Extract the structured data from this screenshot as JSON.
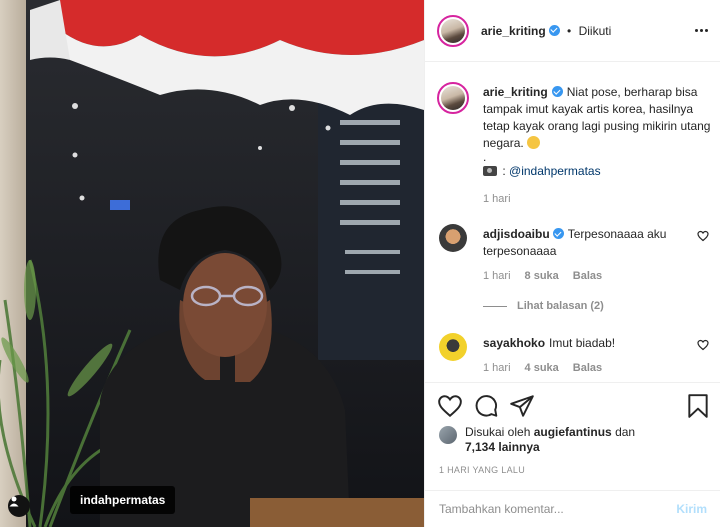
{
  "photo": {
    "tagged_user": "indahpermatas",
    "icons": {
      "tag": "person-tag-icon"
    }
  },
  "header": {
    "username": "arie_kriting",
    "separator": "•",
    "follow_status": "Diikuti",
    "icons": {
      "verified": "verified-badge-icon",
      "more": "more-options-icon"
    }
  },
  "caption": {
    "username": "arie_kriting",
    "text": "Niat pose, berharap bisa tampak imut kayak artis korea, hasilnya tetap kayak orang lagi pusing mikirin utang negara.",
    "emoji": "pensive-face-emoji",
    "dot": ".",
    "credit_prefix": ":",
    "credit_mention": "@indahpermatas",
    "time": "1 hari"
  },
  "comments": [
    {
      "username": "adjisdoaibu",
      "verified": true,
      "text": "Terpesonaaaa aku terpesonaaaa",
      "time": "1 hari",
      "likes": "8 suka",
      "reply": "Balas",
      "view_replies": "Lihat balasan (2)"
    },
    {
      "username": "sayakhoko",
      "verified": false,
      "text": "Imut biadab!",
      "time": "1 hari",
      "likes": "4 suka",
      "reply": "Balas"
    }
  ],
  "actions": {
    "icons": [
      "heart-icon",
      "comment-icon",
      "share-icon",
      "bookmark-icon"
    ],
    "liked_by_prefix": "Disukai oleh",
    "liked_by_user": "augiefantinus",
    "liked_by_and": "dan",
    "others": "7,134 lainnya",
    "post_date": "1 HARI YANG LALU"
  },
  "composer": {
    "placeholder": "Tambahkan komentar...",
    "post_label": "Kirim"
  },
  "colors": {
    "accent_blue": "#3897f0",
    "text": "#262626",
    "muted": "#8e8e8e",
    "post_disabled": "#b2dffc",
    "story_ring": "#d6249f"
  }
}
